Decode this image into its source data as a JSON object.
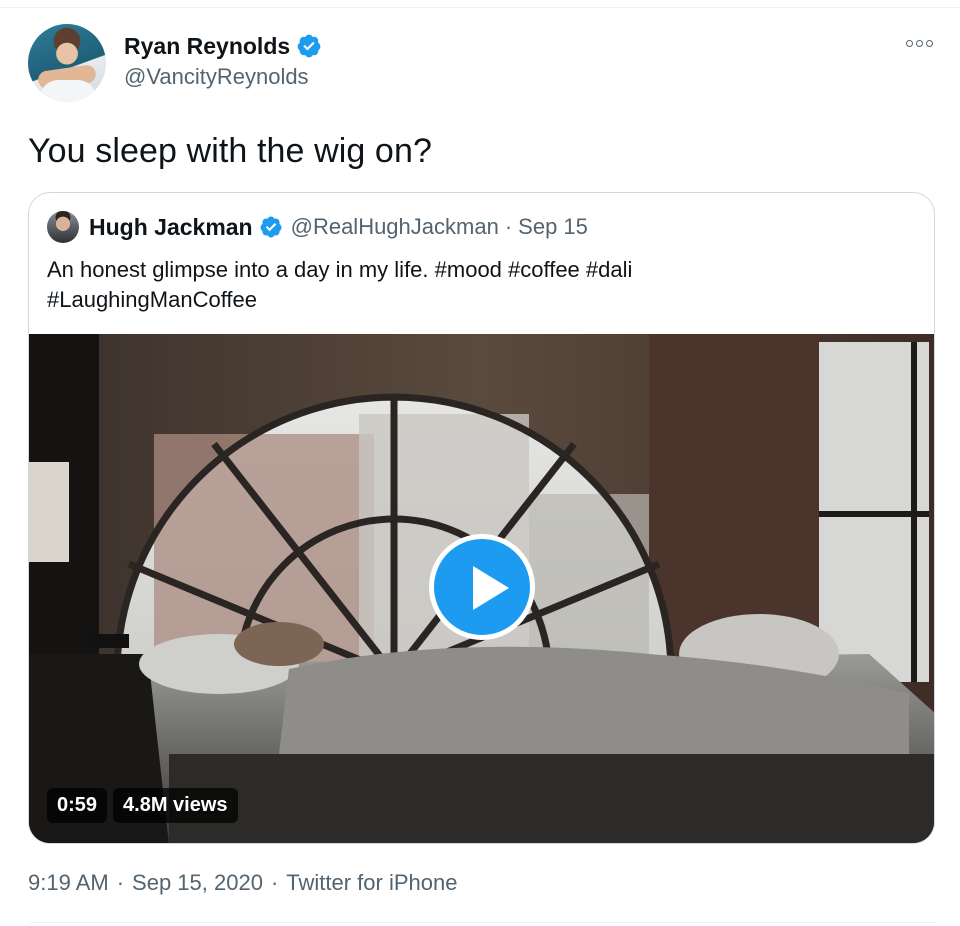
{
  "author": {
    "name": "Ryan Reynolds",
    "handle": "@VancityReynolds",
    "verified": true
  },
  "tweet": {
    "text": "You sleep with the wig on?"
  },
  "quoted": {
    "name": "Hugh Jackman",
    "handle": "@RealHughJackman",
    "separator": "·",
    "date": "Sep 15",
    "text_line1": "An honest glimpse into a day in my life. #mood #coffee #dali",
    "text_line2": "#LaughingManCoffee",
    "video": {
      "duration": "0:59",
      "views": "4.8M views"
    }
  },
  "footer": {
    "time": "9:19 AM",
    "sep1": "·",
    "date": "Sep 15, 2020",
    "sep2": "·",
    "source": "Twitter for iPhone"
  },
  "icons": [
    "verified-badge-icon",
    "more-options-icon",
    "play-icon"
  ],
  "colors": {
    "accent": "#1d9bf0",
    "secondary_text": "#536471",
    "border": "#cfd9de"
  }
}
